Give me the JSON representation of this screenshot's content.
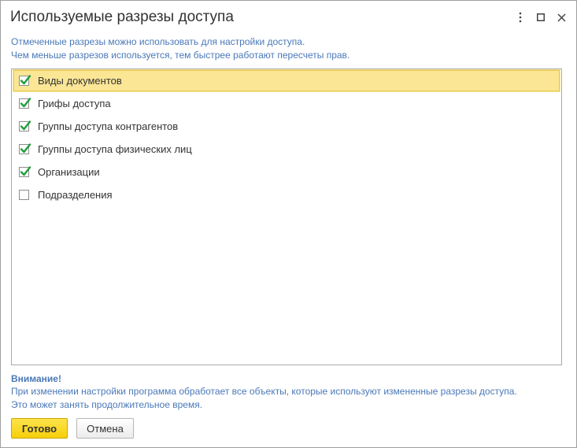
{
  "window": {
    "title": "Используемые разрезы доступа"
  },
  "controls": {
    "more_icon": "vertical-dots",
    "maximize_icon": "square",
    "close_icon": "x"
  },
  "info": {
    "line1": "Отмеченные разрезы можно использовать для настройки доступа.",
    "line2": "Чем меньше разрезов используется, тем быстрее работают пересчеты прав."
  },
  "list": {
    "items": [
      {
        "label": "Виды документов",
        "checked": true,
        "selected": true
      },
      {
        "label": "Грифы доступа",
        "checked": true,
        "selected": false
      },
      {
        "label": "Группы доступа контрагентов",
        "checked": true,
        "selected": false
      },
      {
        "label": "Группы доступа физических лиц",
        "checked": true,
        "selected": false
      },
      {
        "label": "Организации",
        "checked": true,
        "selected": false
      },
      {
        "label": "Подразделения",
        "checked": false,
        "selected": false
      }
    ]
  },
  "warning": {
    "title": "Внимание!",
    "line1": "При изменении настройки программа обработает все объекты, которые используют измененные разрезы доступа.",
    "line2": "Это может занять продолжительное время."
  },
  "buttons": {
    "ok_label": "Готово",
    "cancel_label": "Отмена"
  },
  "colors": {
    "accent_text": "#4a78b8",
    "selected_row": "#fbe696",
    "check_mark": "#1f9e3b",
    "primary_button": "#f6cf0a"
  }
}
